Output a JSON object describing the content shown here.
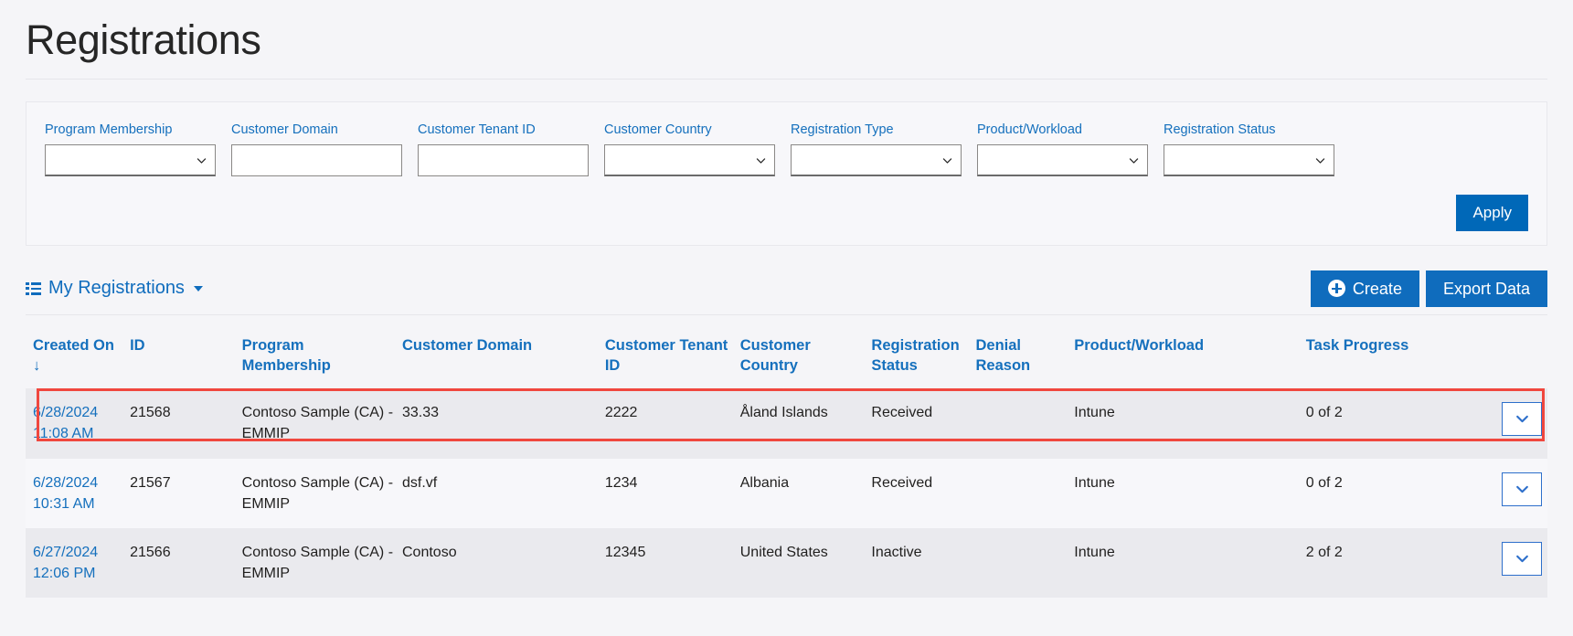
{
  "page": {
    "title": "Registrations"
  },
  "filters": {
    "fields": [
      {
        "label": "Program Membership",
        "type": "select",
        "value": "",
        "icon": "chevron-down-icon"
      },
      {
        "label": "Customer Domain",
        "type": "text",
        "value": "",
        "placeholder": ""
      },
      {
        "label": "Customer Tenant ID",
        "type": "text",
        "value": "",
        "placeholder": ""
      },
      {
        "label": "Customer Country",
        "type": "select",
        "value": "",
        "icon": "chevron-down-icon"
      },
      {
        "label": "Registration Type",
        "type": "select",
        "value": "",
        "icon": "chevron-down-icon"
      },
      {
        "label": "Product/Workload",
        "type": "select",
        "value": "",
        "icon": "chevron-down-icon"
      },
      {
        "label": "Registration Status",
        "type": "select",
        "value": "",
        "icon": "chevron-down-icon"
      }
    ],
    "apply_label": "Apply",
    "apply_color": "#0068b8"
  },
  "toolbar": {
    "view_label": "My Registrations",
    "view_icon": "list-icon",
    "view_caret_icon": "caret-down-icon",
    "create_label": "Create",
    "create_icon": "plus-circle-icon",
    "export_label": "Export Data",
    "button_color": "#0f6cbd"
  },
  "table": {
    "headers": [
      "Created On ↓",
      "ID",
      "Program Membership",
      "Customer Domain",
      "Customer Tenant ID",
      "Customer Country",
      "Registration Status",
      "Denial Reason",
      "Product/Workload",
      "Task Progress",
      ""
    ],
    "sort_column": "Created On",
    "sort_direction": "desc",
    "rows": [
      {
        "created_date": "6/28/2024",
        "created_time": "11:08 AM",
        "id": "21568",
        "program_membership": "Contoso Sample (CA) - EMMIP",
        "customer_domain": "33.33",
        "customer_tenant_id": "2222",
        "customer_country": "Åland Islands",
        "registration_status": "Received",
        "denial_reason": "",
        "product_workload": "Intune",
        "task_progress": "0 of 2",
        "expand_icon": "chevron-down-icon",
        "highlighted": true,
        "shade": "alt"
      },
      {
        "created_date": "6/28/2024",
        "created_time": "10:31 AM",
        "id": "21567",
        "program_membership": "Contoso Sample (CA) - EMMIP",
        "customer_domain": "dsf.vf",
        "customer_tenant_id": "1234",
        "customer_country": "Albania",
        "registration_status": "Received",
        "denial_reason": "",
        "product_workload": "Intune",
        "task_progress": "0 of 2",
        "expand_icon": "chevron-down-icon",
        "highlighted": false,
        "shade": "plain"
      },
      {
        "created_date": "6/27/2024",
        "created_time": "12:06 PM",
        "id": "21566",
        "program_membership": "Contoso Sample (CA) - EMMIP",
        "customer_domain": "Contoso",
        "customer_tenant_id": "12345",
        "customer_country": "United States",
        "registration_status": "Inactive",
        "denial_reason": "",
        "product_workload": "Intune",
        "task_progress": "2 of 2",
        "expand_icon": "chevron-down-icon",
        "highlighted": false,
        "shade": "alt"
      }
    ]
  },
  "annotation": {
    "highlight_color": "#f0473e",
    "target_row_index": 0
  }
}
